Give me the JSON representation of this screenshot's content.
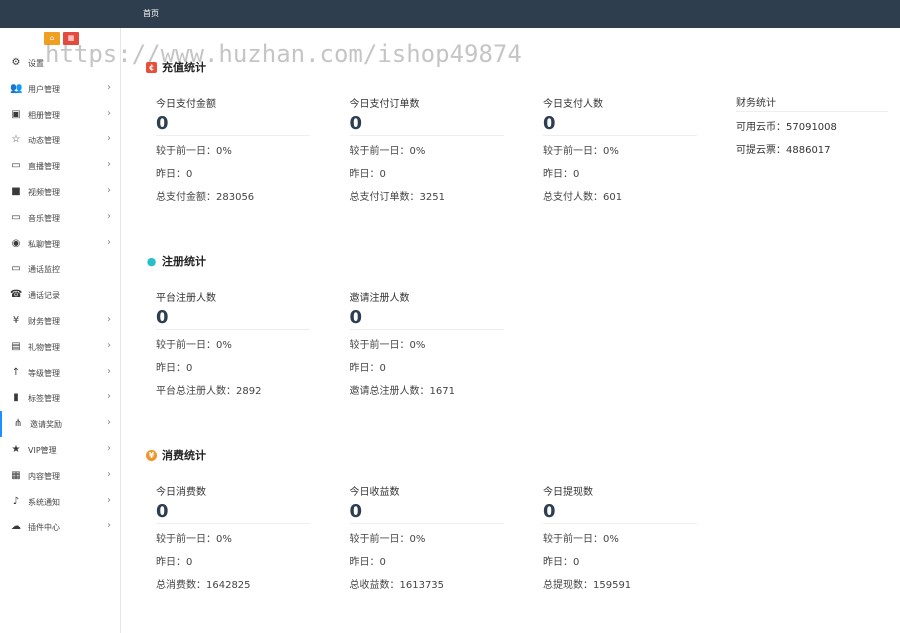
{
  "header": {
    "home": "首页"
  },
  "sidebar": {
    "quick": [
      {
        "icon": "home-icon",
        "glyph": "⌂"
      },
      {
        "icon": "shop-icon",
        "glyph": "▦"
      }
    ],
    "items": [
      {
        "label": "设置",
        "icon": "gears-icon",
        "glyph": "⚙",
        "chevron": ""
      },
      {
        "label": "用户管理",
        "icon": "users-icon",
        "glyph": "👥",
        "chevron": "›"
      },
      {
        "label": "相册管理",
        "icon": "image-icon",
        "glyph": "▣",
        "chevron": "›"
      },
      {
        "label": "动态管理",
        "icon": "star-outline-icon",
        "glyph": "☆",
        "chevron": "›"
      },
      {
        "label": "直播管理",
        "icon": "monitor-icon",
        "glyph": "▭",
        "chevron": "›"
      },
      {
        "label": "视频管理",
        "icon": "video-camera-icon",
        "glyph": "■",
        "chevron": "›"
      },
      {
        "label": "音乐管理",
        "icon": "desktop-icon",
        "glyph": "▭",
        "chevron": "›"
      },
      {
        "label": "私聊管理",
        "icon": "telegram-icon",
        "glyph": "◉",
        "chevron": "›"
      },
      {
        "label": "通话监控",
        "icon": "screen-icon",
        "glyph": "▭",
        "chevron": ""
      },
      {
        "label": "通话记录",
        "icon": "phone-icon",
        "glyph": "☎",
        "chevron": ""
      },
      {
        "label": "财务管理",
        "icon": "yen-icon",
        "glyph": "¥",
        "chevron": "›"
      },
      {
        "label": "礼物管理",
        "icon": "gift-icon",
        "glyph": "▤",
        "chevron": "›"
      },
      {
        "label": "等级管理",
        "icon": "level-arrow-icon",
        "glyph": "↑",
        "chevron": "›"
      },
      {
        "label": "标签管理",
        "icon": "bookmark-icon",
        "glyph": "▮",
        "chevron": "›"
      },
      {
        "label": "邀请奖励",
        "icon": "sitemap-icon",
        "glyph": "⋔",
        "chevron": "›"
      },
      {
        "label": "VIP管理",
        "icon": "star-icon",
        "glyph": "★",
        "chevron": "›"
      },
      {
        "label": "内容管理",
        "icon": "grid-icon",
        "glyph": "▦",
        "chevron": "›"
      },
      {
        "label": "系统通知",
        "icon": "bell-icon",
        "glyph": "♪",
        "chevron": "›"
      },
      {
        "label": "插件中心",
        "icon": "cloud-icon",
        "glyph": "☁",
        "chevron": "›"
      }
    ]
  },
  "watermark": "https://www.huzhan.com/ishop49874",
  "recharge": {
    "title": "充值统计",
    "icon": "recharge-icon",
    "stats": [
      {
        "label": "今日支付金额",
        "value": "0",
        "compare": "较于前一日：0%",
        "yesterday": "昨日：0",
        "total": "总支付金额：283056"
      },
      {
        "label": "今日支付订单数",
        "value": "0",
        "compare": "较于前一日：0%",
        "yesterday": "昨日：0",
        "total": "总支付订单数：3251"
      },
      {
        "label": "今日支付人数",
        "value": "0",
        "compare": "较于前一日：0%",
        "yesterday": "昨日：0",
        "total": "总支付人数：601"
      }
    ]
  },
  "finance": {
    "title": "财务统计",
    "coins": "可用云币：57091008",
    "tickets": "可提云票：4886017"
  },
  "register": {
    "title": "注册统计",
    "icon": "user-icon",
    "stats": [
      {
        "label": "平台注册人数",
        "value": "0",
        "compare": "较于前一日：0%",
        "yesterday": "昨日：0",
        "total": "平台总注册人数：2892"
      },
      {
        "label": "邀请注册人数",
        "value": "0",
        "compare": "较于前一日：0%",
        "yesterday": "昨日：0",
        "total": "邀请总注册人数：1671"
      }
    ]
  },
  "consume": {
    "title": "消费统计",
    "icon": "yen-circle-icon",
    "stats": [
      {
        "label": "今日消费数",
        "value": "0",
        "compare": "较于前一日：0%",
        "yesterday": "昨日：0",
        "total": "总消费数：1642825"
      },
      {
        "label": "今日收益数",
        "value": "0",
        "compare": "较于前一日：0%",
        "yesterday": "昨日：0",
        "total": "总收益数：1613735"
      },
      {
        "label": "今日提现数",
        "value": "0",
        "compare": "较于前一日：0%",
        "yesterday": "昨日：0",
        "total": "总提现数：159591"
      }
    ]
  }
}
